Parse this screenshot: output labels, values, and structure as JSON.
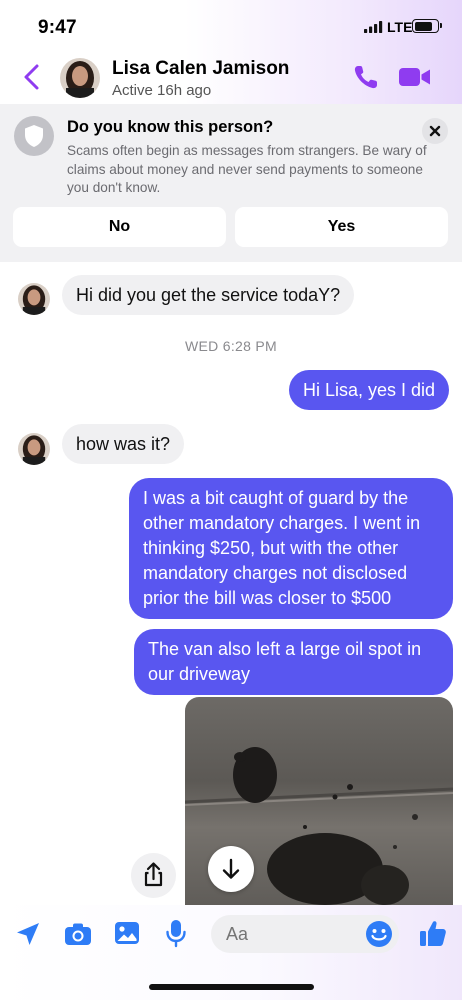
{
  "status_bar": {
    "time": "9:47",
    "network": "LTE",
    "battery_level": 0.85
  },
  "header": {
    "contact_name": "Lisa Calen Jamison",
    "contact_status": "Active 16h ago",
    "icons": [
      "chevron-left-icon",
      "phone-icon",
      "video-camera-icon"
    ],
    "accent_color": "#8f3cf0"
  },
  "safety_banner": {
    "title": "Do you know this person?",
    "text": "Scams often begin as messages from strangers. Be wary of claims about money and never send payments to someone you don't know.",
    "no_label": "No",
    "yes_label": "Yes"
  },
  "messages": [
    {
      "direction": "incoming",
      "text": "Hi did you get the service todaY?"
    },
    {
      "type": "timestamp",
      "text": "WED 6:28 PM"
    },
    {
      "direction": "outgoing",
      "text": "Hi Lisa, yes I did"
    },
    {
      "direction": "incoming",
      "text": "how was it?"
    },
    {
      "direction": "outgoing",
      "text": "I was a bit caught of guard by the other mandatory charges. I went in thinking $250, but with the other mandatory charges not disclosed prior the bill was closer to $500"
    },
    {
      "direction": "outgoing",
      "text": "The van also left a large oil spot in our driveway"
    },
    {
      "direction": "outgoing",
      "type": "photo"
    }
  ],
  "composer": {
    "placeholder": "Aa",
    "icons": [
      "location-arrow-icon",
      "camera-icon",
      "image-icon",
      "microphone-icon",
      "emoji-icon",
      "thumbs-up-icon"
    ]
  },
  "colors": {
    "outgoing_bubble": "#5956f0",
    "incoming_bubble": "#f0f0f2",
    "composer_icon": "#2e7cf6"
  }
}
